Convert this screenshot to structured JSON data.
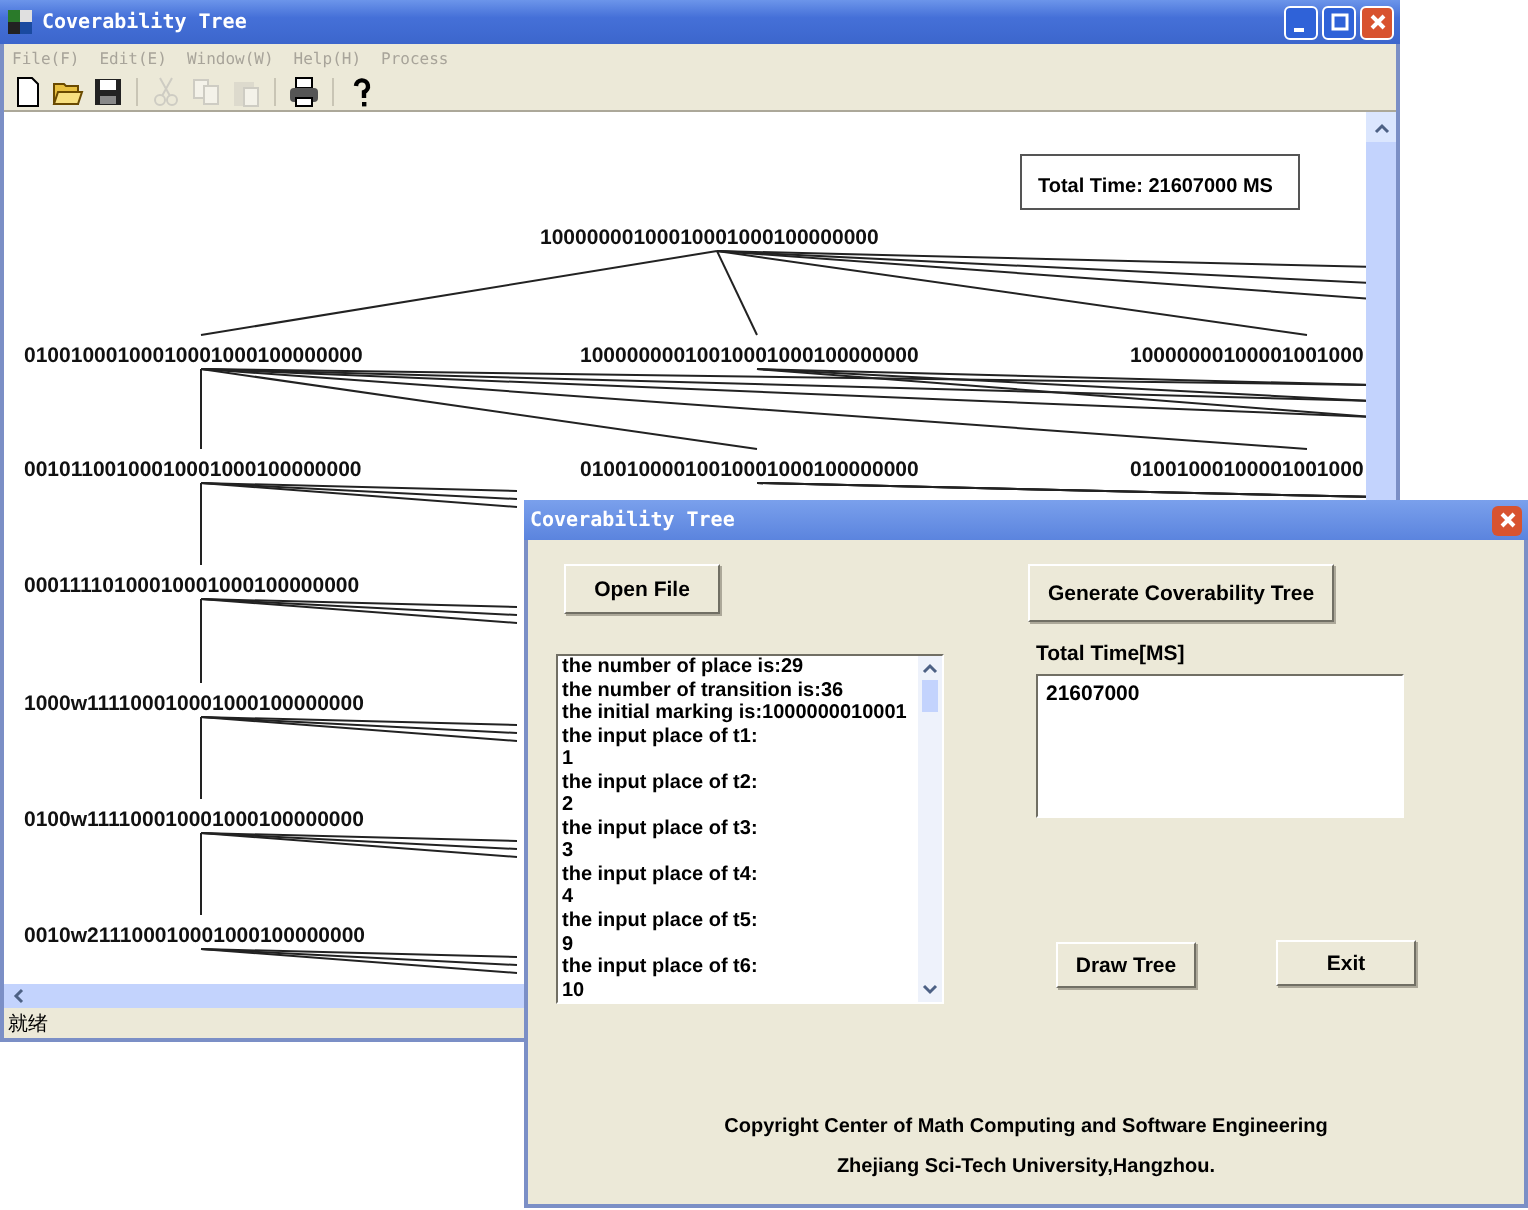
{
  "main_window": {
    "title": "Coverability Tree",
    "menu": [
      {
        "label": "File(F)",
        "disabled": true
      },
      {
        "label": "Edit(E)",
        "disabled": true
      },
      {
        "label": "Window(W)",
        "disabled": true
      },
      {
        "label": "Help(H)",
        "disabled": true
      },
      {
        "label": "Process",
        "disabled": true
      }
    ],
    "toolbar": [
      {
        "kind": "new",
        "disabled": false
      },
      {
        "kind": "open",
        "disabled": false
      },
      {
        "kind": "save",
        "disabled": false
      },
      {
        "kind": "sep"
      },
      {
        "kind": "cut",
        "disabled": true
      },
      {
        "kind": "copy",
        "disabled": true
      },
      {
        "kind": "paste",
        "disabled": true
      },
      {
        "kind": "sep"
      },
      {
        "kind": "print",
        "disabled": false
      },
      {
        "kind": "sep"
      },
      {
        "kind": "help",
        "disabled": false
      }
    ],
    "total_time": "Total Time: 21607000  MS",
    "tree": {
      "label": "10000000100010001000100000000",
      "children": [
        {
          "label": "01001000100010001000100000000",
          "children": [
            {
              "label": "00101100100010001000100000000",
              "children": [
                {
                  "label": "00011110100010001000100000000",
                  "children": [
                    {
                      "label": "1000w111100010001000100000000",
                      "children": [
                        {
                          "label": "0100w111100010001000100000000",
                          "children": [
                            {
                              "label": "0010w211100010001000100000000"
                            }
                          ]
                        }
                      ]
                    }
                  ]
                }
              ]
            },
            {
              "label": "01001000010010001000100000000"
            },
            {
              "label": "01001000100001001000"
            }
          ]
        },
        {
          "label": "10000000010010001000100000000"
        },
        {
          "label": "10000000100001001000"
        }
      ]
    },
    "status": "就绪"
  },
  "dialog": {
    "title": "Coverability Tree",
    "open_button": "Open File",
    "generate_button": "Generate Coverability Tree",
    "log": [
      "the number of place is:29",
      "the number of transition is:36",
      "the initial marking is:1000000010001",
      "the input place of t1:",
      "1",
      "the input place of t2:",
      "2",
      "the input place of t3:",
      "3",
      "the input place of t4:",
      "4",
      "the input place of t5:",
      "9",
      "the input place of t6:",
      "10"
    ],
    "time_label": "Total Time[MS]",
    "time_value": "21607000",
    "draw_button": "Draw Tree",
    "exit_button": "Exit",
    "copyright": [
      "Copyright Center of Math Computing and Software Engineering",
      "Zhejiang Sci-Tech University,Hangzhou."
    ]
  }
}
